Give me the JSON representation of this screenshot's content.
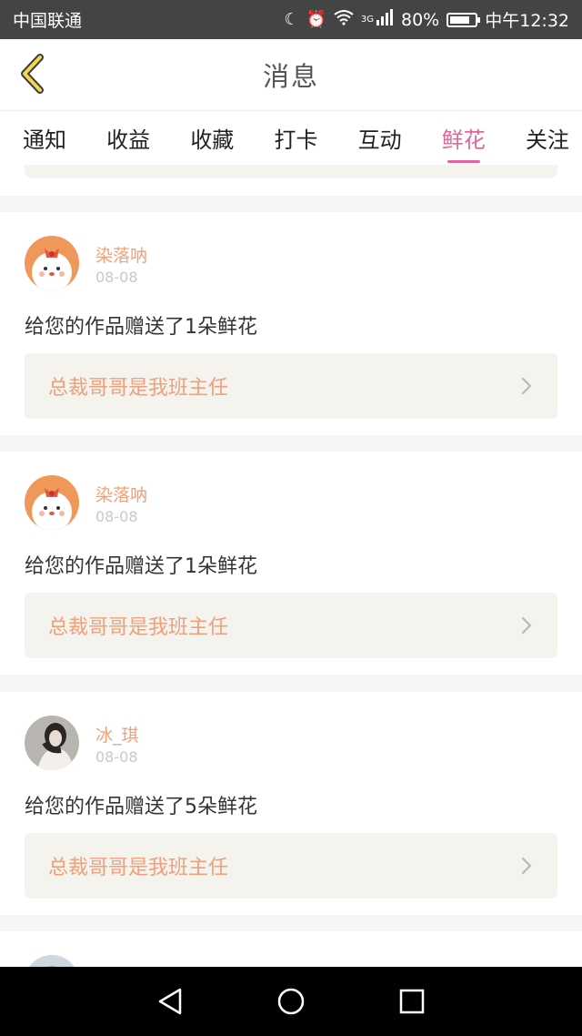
{
  "status_bar": {
    "carrier": "中国联通",
    "network": "3G",
    "battery": "80%",
    "battery_level": 0.8,
    "time": "中午12:32",
    "icons": [
      "moon-icon",
      "alarm-icon",
      "wifi-icon",
      "signal-icon",
      "battery-icon"
    ]
  },
  "header": {
    "title": "消息",
    "back_icon": "back-chevron-icon"
  },
  "tabs": [
    {
      "label": "通知",
      "active": false
    },
    {
      "label": "收益",
      "active": false
    },
    {
      "label": "收藏",
      "active": false
    },
    {
      "label": "打卡",
      "active": false
    },
    {
      "label": "互动",
      "active": false
    },
    {
      "label": "鲜花",
      "active": true
    },
    {
      "label": "关注",
      "active": false
    }
  ],
  "colors": {
    "accent": "#e2649b",
    "name_color": "#f0a07a",
    "work_bg": "#f4f3ed"
  },
  "messages": [
    {
      "name": "染落呐",
      "date": "08-08",
      "text": "给您的作品赠送了1朵鲜花",
      "work_title": "总裁哥哥是我班主任",
      "avatar": "cartoon-avatar"
    },
    {
      "name": "染落呐",
      "date": "08-08",
      "text": "给您的作品赠送了1朵鲜花",
      "work_title": "总裁哥哥是我班主任",
      "avatar": "cartoon-avatar"
    },
    {
      "name": "冰_琪",
      "date": "08-08",
      "text": "给您的作品赠送了5朵鲜花",
      "work_title": "总裁哥哥是我班主任",
      "avatar": "photo-avatar"
    }
  ],
  "nav_bar": {
    "icons": [
      "back-triangle-icon",
      "home-circle-icon",
      "recents-square-icon"
    ]
  }
}
